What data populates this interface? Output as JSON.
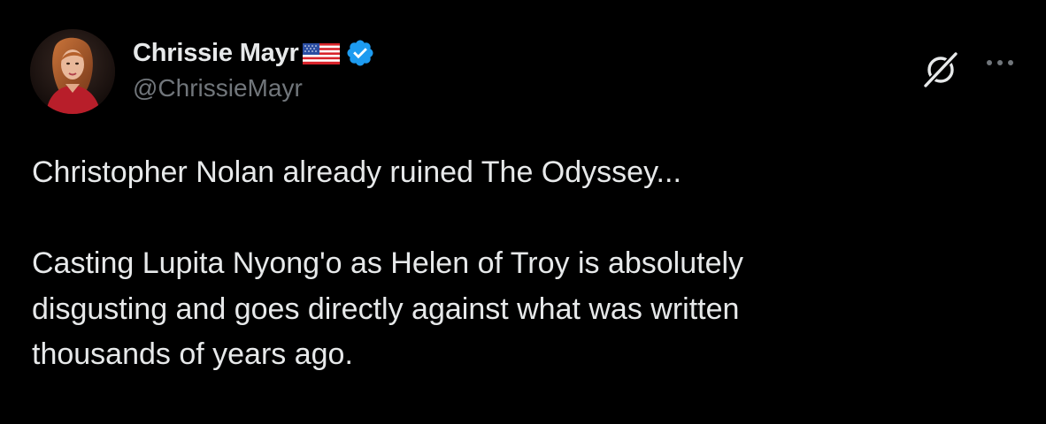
{
  "author": {
    "display_name": "Chrissie Mayr",
    "handle": "@ChrissieMayr",
    "flag_icon": "us-flag-icon",
    "verified_icon": "verified-badge-icon",
    "verified_color": "#1d9bf0"
  },
  "actions": {
    "grok_icon": "grok-icon",
    "more_icon": "more-horizontal-icon"
  },
  "tweet": {
    "paragraph_1": "Christopher Nolan already ruined The Odyssey...",
    "paragraph_2_line_1": "Casting Lupita Nyong'o as Helen of Troy is absolutely",
    "paragraph_2_line_2": "disgusting and goes directly against what was written",
    "paragraph_2_line_3": "thousands of years ago."
  },
  "colors": {
    "background": "#000000",
    "primary_text": "#e7e9ea",
    "secondary_text": "#71767b",
    "accent": "#1d9bf0"
  }
}
